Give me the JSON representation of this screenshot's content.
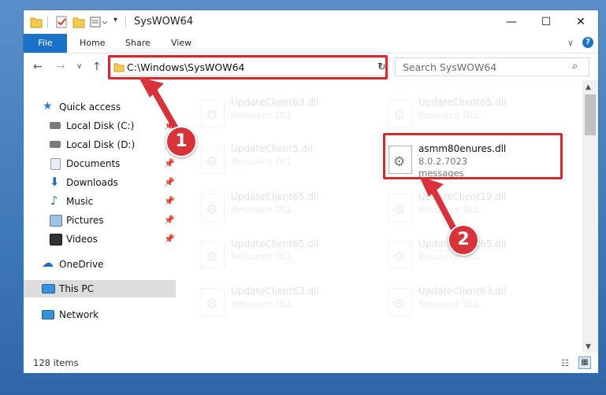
{
  "window": {
    "title": "SysWOW64"
  },
  "ribbon": {
    "tabs": [
      "File",
      "Home",
      "Share",
      "View"
    ]
  },
  "address": {
    "path": "C:\\Windows\\SysWOW64"
  },
  "search": {
    "placeholder": "Search SysWOW64"
  },
  "sidebar": {
    "items": [
      {
        "label": "Quick access"
      },
      {
        "label": "Local Disk (C:)"
      },
      {
        "label": "Local Disk (D:)"
      },
      {
        "label": "Documents"
      },
      {
        "label": "Downloads"
      },
      {
        "label": "Music"
      },
      {
        "label": "Pictures"
      },
      {
        "label": "Videos"
      },
      {
        "label": "OneDrive"
      },
      {
        "label": "This PC"
      },
      {
        "label": "Network"
      }
    ]
  },
  "files": [
    {
      "name": "UpdateClient63.dll",
      "type": "Resource DLL"
    },
    {
      "name": "UpdateClient65.dll",
      "type": "Resource DLL"
    },
    {
      "name": "UpdateClient5.dll",
      "type": "Resource DLL"
    },
    {
      "name": "asmm80enures.dll",
      "version": "8.0.2.7023",
      "description": "messages"
    },
    {
      "name": "UpdateClient65.dll",
      "type": "Resource DLL"
    },
    {
      "name": "UpdateClient19.dll",
      "type": "Resource DLL"
    },
    {
      "name": "UpdateClient65.dll",
      "type": "Resource DLL"
    },
    {
      "name": "UpdateClient65.dll",
      "type": "Resource DLL"
    },
    {
      "name": "UpdateClient63.dll",
      "type": "Resource DLL"
    },
    {
      "name": "UpdateClient63.dll",
      "type": "Resource DLL"
    }
  ],
  "status": {
    "count": "128 items"
  },
  "annotations": {
    "step1": "1",
    "step2": "2",
    "color": "#d8282f"
  }
}
